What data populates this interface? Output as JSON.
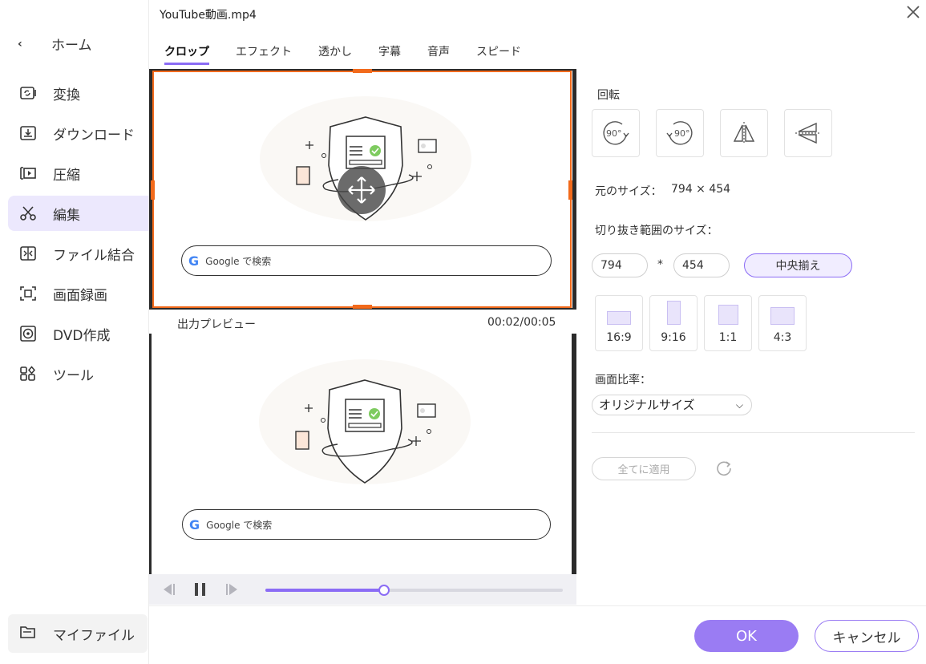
{
  "window": {
    "title": "YouTube動画.mp4"
  },
  "sidebar": {
    "home_label": "ホーム",
    "items": [
      {
        "label": "変換",
        "icon": "convert-icon"
      },
      {
        "label": "ダウンロード",
        "icon": "download-icon"
      },
      {
        "label": "圧縮",
        "icon": "compress-icon"
      },
      {
        "label": "編集",
        "icon": "scissors-icon",
        "active": true
      },
      {
        "label": "ファイル結合",
        "icon": "merge-icon"
      },
      {
        "label": "画面録画",
        "icon": "screen-record-icon"
      },
      {
        "label": "DVD作成",
        "icon": "dvd-icon"
      },
      {
        "label": "ツール",
        "icon": "tools-icon"
      }
    ],
    "myfiles_label": "マイファイル"
  },
  "tabs": [
    {
      "label": "クロップ",
      "active": true
    },
    {
      "label": "エフェクト"
    },
    {
      "label": "透かし"
    },
    {
      "label": "字幕"
    },
    {
      "label": "音声"
    },
    {
      "label": "スピード"
    }
  ],
  "preview": {
    "search_text": "Google で検索",
    "google_g": "G",
    "output_label": "出力プレビュー",
    "timecode": "00:02/00:05",
    "progress": 0.4
  },
  "panel": {
    "rotate_label": "回転",
    "rotate_cw": "90°",
    "rotate_ccw": "90°",
    "source_size_label": "元のサイズ：",
    "source_size_value": "794 × 454",
    "crop_size_label": "切り抜き範囲のサイズ：",
    "crop_width": "794",
    "crop_sep": "*",
    "crop_height": "454",
    "center_label": "中央揃え",
    "ratios": [
      "16:9",
      "9:16",
      "1:1",
      "4:3"
    ],
    "aspect_label": "画面比率：",
    "aspect_value": "オリジナルサイズ",
    "apply_all_label": "全てに適用"
  },
  "footer": {
    "ok_label": "OK",
    "cancel_label": "キャンセル"
  },
  "colors": {
    "accent": "#9a7cf3",
    "crop": "#f26a1b",
    "active_bg": "#ece8fd"
  }
}
